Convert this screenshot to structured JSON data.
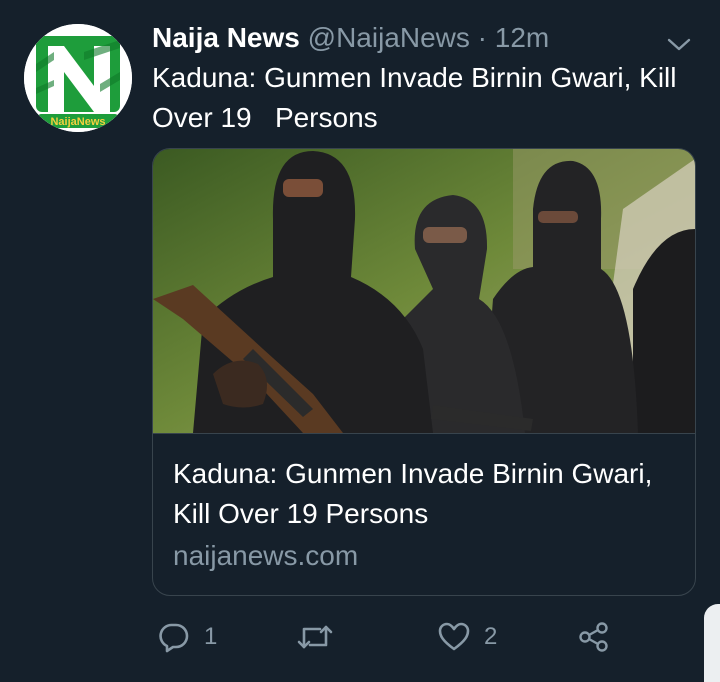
{
  "tweet": {
    "author_name": "Naija News",
    "handle": "@NaijaNews",
    "separator": "·",
    "time": "12m",
    "avatar_label": "NaijaNews",
    "text": "Kaduna: Gunmen Invade Birnin Gwari, Kill Over 19   Persons"
  },
  "card": {
    "title": "Kaduna: Gunmen Invade Birnin Gwari, Kill Over 19 Persons",
    "domain": "naijanews.com"
  },
  "actions": {
    "reply_count": "1",
    "like_count": "2"
  },
  "icons": [
    "chevron-down-icon",
    "reply-icon",
    "retweet-icon",
    "like-icon",
    "share-icon"
  ],
  "colors": {
    "background": "#15202b",
    "secondary_text": "#8899a6",
    "border": "#38444d",
    "logo_green": "#1e9d3b"
  }
}
